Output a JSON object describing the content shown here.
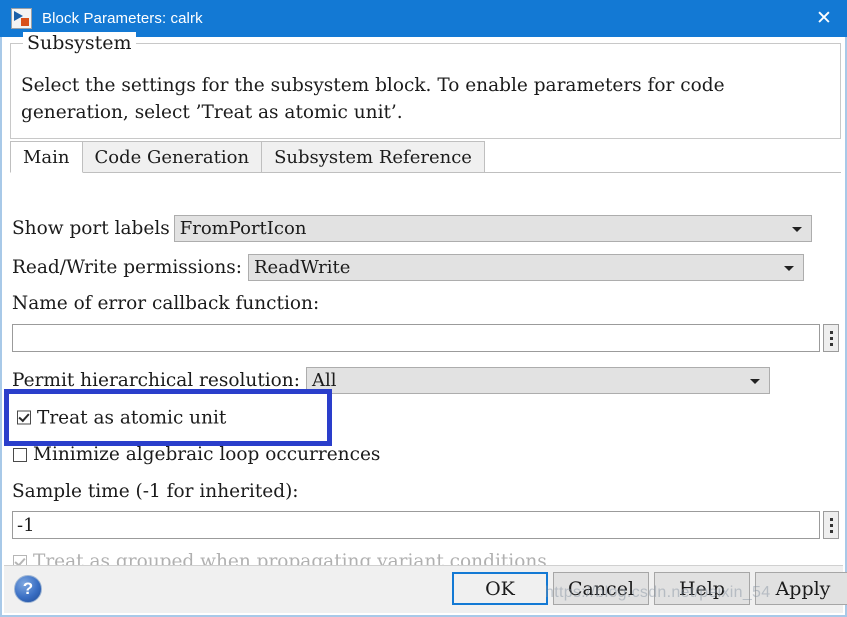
{
  "window": {
    "title": "Block Parameters: calrk",
    "icon": "simulink-block-icon",
    "close_label": "✕",
    "titlebar_color": "#1379d4"
  },
  "description": {
    "group_title": "Subsystem",
    "body": "Select the settings for the subsystem block. To enable parameters for code generation, select ’Treat as atomic unit’."
  },
  "tabs": [
    {
      "label": "Main",
      "active": true
    },
    {
      "label": "Code Generation",
      "active": false
    },
    {
      "label": "Subsystem Reference",
      "active": false
    }
  ],
  "fields": {
    "show_port_labels": {
      "label": "Show port labels",
      "value": "FromPortIcon"
    },
    "read_write_permissions": {
      "label": "Read/Write permissions:",
      "value": "ReadWrite"
    },
    "error_callback": {
      "label": "Name of error callback function:",
      "value": "",
      "placeholder": ""
    },
    "permit_hierarchical_resolution": {
      "label": "Permit hierarchical resolution:",
      "value": "All"
    },
    "treat_as_atomic_unit": {
      "label": "Treat as atomic unit",
      "checked": true
    },
    "minimize_algebraic_loop": {
      "label": "Minimize algebraic loop occurrences",
      "checked": false
    },
    "sample_time": {
      "label": "Sample time (-1 for inherited):",
      "value": "-1"
    },
    "treat_as_grouped": {
      "label": "Treat as grouped when propagating variant conditions",
      "checked": true,
      "disabled": true
    }
  },
  "annotation": {
    "color": "#2a3ecb",
    "highlights": "treat-as-atomic-unit"
  },
  "footer": {
    "help_glyph": "?",
    "buttons": [
      {
        "label": "OK",
        "primary": true
      },
      {
        "label": "Cancel",
        "primary": false
      },
      {
        "label": "Help",
        "primary": false
      },
      {
        "label": "Apply",
        "primary": false
      }
    ]
  },
  "watermark": {
    "text": "https://blog.csdn.net/peixin_54"
  }
}
